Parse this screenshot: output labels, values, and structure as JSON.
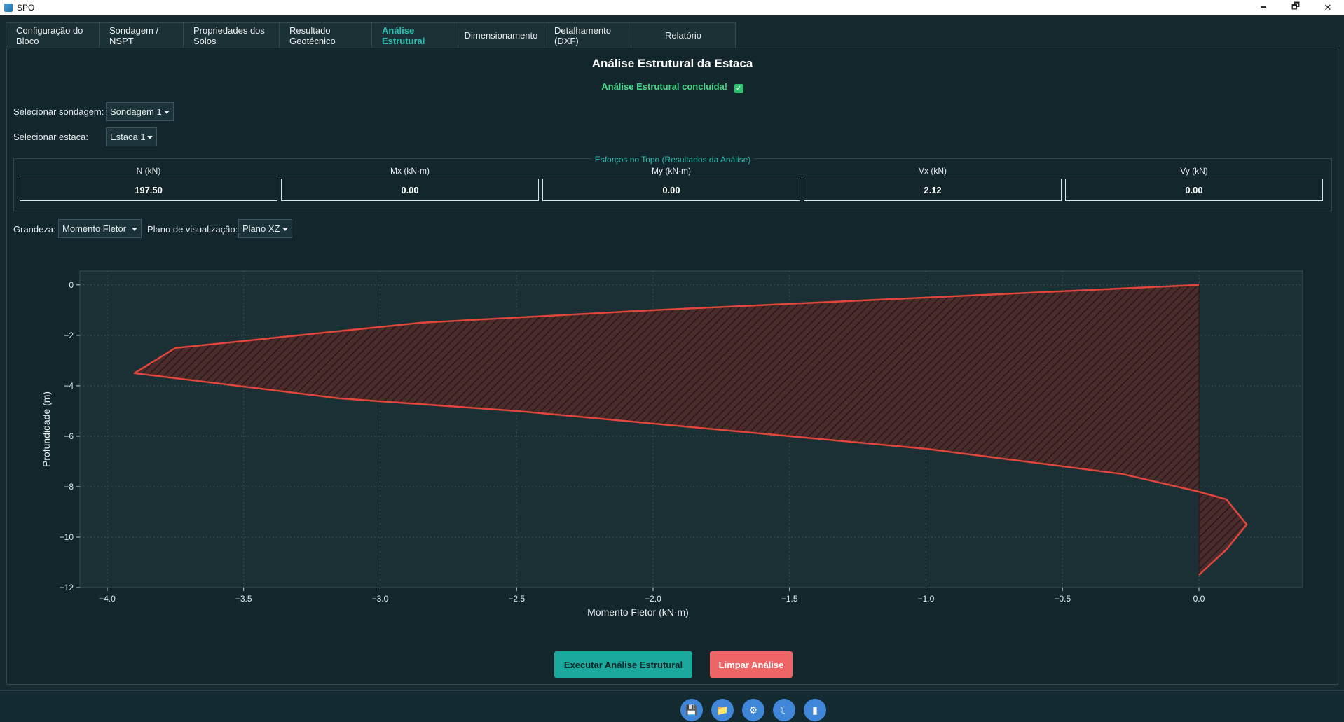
{
  "window": {
    "title": "SPO",
    "minimize": "🗕",
    "maximize": "🗗",
    "close": "✕"
  },
  "tabs": [
    "Configuração do Bloco",
    "Sondagem / NSPT",
    "Propriedades dos Solos",
    "Resultado Geotécnico",
    "Análise Estrutural",
    "Dimensionamento",
    "Detalhamento (DXF)",
    "Relatório"
  ],
  "active_tab": "Análise Estrutural",
  "page": {
    "title": "Análise Estrutural da Estaca",
    "status": "Análise Estrutural concluída!",
    "status_check": "✓"
  },
  "selectors": {
    "sondagem_label": "Selecionar sondagem:",
    "sondagem_value": "Sondagem 1",
    "estaca_label": "Selecionar estaca:",
    "estaca_value": "Estaca 1"
  },
  "efforts": {
    "group_title": "Esforços no Topo (Resultados da Análise)",
    "fields": [
      {
        "label": "N (kN)",
        "value": "197.50"
      },
      {
        "label": "Mx (kN·m)",
        "value": "0.00"
      },
      {
        "label": "My (kN·m)",
        "value": "0.00"
      },
      {
        "label": "Vx (kN)",
        "value": "2.12"
      },
      {
        "label": "Vy (kN)",
        "value": "0.00"
      }
    ]
  },
  "view_controls": {
    "grandeza_label": "Grandeza:",
    "grandeza_value": "Momento Fletor",
    "plano_label": "Plano de visualização:",
    "plano_value": "Plano XZ"
  },
  "chart_data": {
    "type": "area",
    "xlabel": "Momento Fletor (kN·m)",
    "ylabel": "Profundidade (m)",
    "xlim": [
      -4.1,
      0.38
    ],
    "ylim": [
      -12,
      0.55
    ],
    "xticks": [
      -4.0,
      -3.5,
      -3.0,
      -2.5,
      -2.0,
      -1.5,
      -1.0,
      -0.5,
      0.0
    ],
    "xtick_labels": [
      "−4.0",
      "−3.5",
      "−3.0",
      "−2.5",
      "−2.0",
      "−1.5",
      "−1.0",
      "−0.5",
      "0.0"
    ],
    "yticks": [
      0,
      -2,
      -4,
      -6,
      -8,
      -10,
      -12
    ],
    "ytick_labels": [
      "0",
      "−2",
      "−4",
      "−6",
      "−8",
      "−10",
      "−12"
    ],
    "grid": true,
    "line_color": "#e0463c",
    "fill_color": "#4a2c2c",
    "x": [
      0.0,
      -1.0,
      -2.0,
      -2.85,
      -3.75,
      -3.9,
      -3.15,
      -2.5,
      -1.0,
      -0.28,
      0.0,
      0.1,
      0.175,
      0.1,
      0.0
    ],
    "y": [
      0.0,
      -0.5,
      -1.0,
      -1.5,
      -2.5,
      -3.5,
      -4.5,
      -5.0,
      -6.5,
      -7.5,
      -8.2,
      -8.5,
      -9.5,
      -10.5,
      -11.5
    ]
  },
  "actions": {
    "run": "Executar Análise Estrutural",
    "clear": "Limpar Análise"
  },
  "toolbar_icons": [
    "save-icon",
    "folder-icon",
    "settings-icon",
    "moon-icon",
    "info-icon"
  ]
}
